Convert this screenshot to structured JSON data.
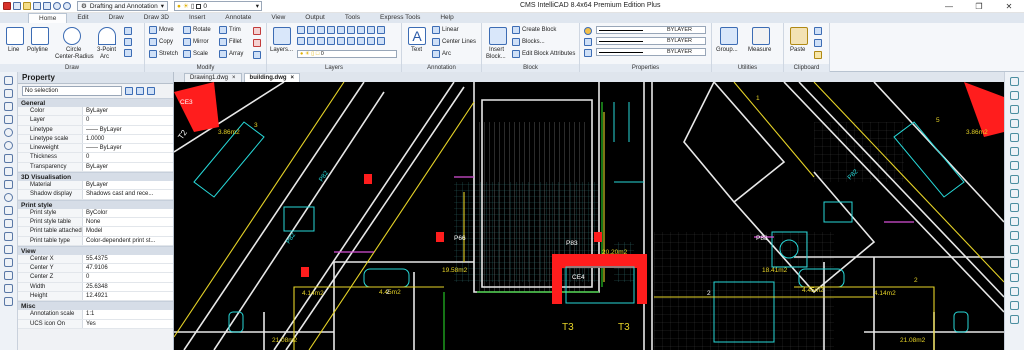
{
  "titlebar": {
    "workspace": "Drafting and Annotation",
    "layer_value": "0",
    "app_title": "CMS IntelliCAD 8.4x64 Premium Edition Plus"
  },
  "menu": [
    "Home",
    "Edit",
    "Draw",
    "Draw 3D",
    "Insert",
    "Annotate",
    "View",
    "Output",
    "Tools",
    "Express Tools",
    "Help"
  ],
  "ribbon": {
    "draw": {
      "label": "Draw",
      "line": "Line",
      "polyline": "Polyline",
      "circle": "Circle",
      "circle2": "Center-Radius",
      "arc": "3-Point",
      "arc2": "Arc"
    },
    "modify": {
      "label": "Modify",
      "items": [
        "Move",
        "Rotate",
        "Trim",
        "Copy",
        "Mirror",
        "Fillet",
        "Stretch",
        "Scale",
        "Array"
      ]
    },
    "layers": {
      "label": "Layers",
      "layers_btn": "Layers...",
      "layer_value": "0"
    },
    "annotation": {
      "label": "Annotation",
      "text": "Text",
      "linear": "Linear",
      "center_lines": "Center Lines",
      "arc": "Arc"
    },
    "block": {
      "label": "Block",
      "insert": "Insert",
      "insert2": "Block...",
      "create": "Create Block",
      "blocks": "Blocks...",
      "edit_attr": "Edit Block Attributes"
    },
    "properties": {
      "label": "Properties",
      "v1": "BYLAYER",
      "v2": "BYLAYER",
      "v3": "BYLAYER"
    },
    "utilities": {
      "label": "Utilities",
      "group": "Group...",
      "measure": "Measure"
    },
    "clipboard": {
      "label": "Clipboard",
      "paste": "Paste"
    }
  },
  "property_panel": {
    "title": "Property",
    "selection": "No selection",
    "sections": [
      {
        "name": "General",
        "rows": [
          [
            "Color",
            "ByLayer"
          ],
          [
            "Layer",
            "0"
          ],
          [
            "Linetype",
            "—— ByLayer"
          ],
          [
            "Linetype scale",
            "1.0000"
          ],
          [
            "Lineweight",
            "—— ByLayer"
          ],
          [
            "Thickness",
            "0"
          ],
          [
            "Transparency",
            "ByLayer"
          ]
        ]
      },
      {
        "name": "3D Visualisation",
        "rows": [
          [
            "Material",
            "ByLayer"
          ],
          [
            "Shadow display",
            "Shadows cast and rece..."
          ]
        ]
      },
      {
        "name": "Print style",
        "rows": [
          [
            "Print style",
            "ByColor"
          ],
          [
            "Print style table",
            "None"
          ],
          [
            "Print table attached to",
            "Model"
          ],
          [
            "Print table type",
            "Color-dependent print st..."
          ]
        ]
      },
      {
        "name": "View",
        "rows": [
          [
            "Center X",
            "55.4375"
          ],
          [
            "Center Y",
            "47.9106"
          ],
          [
            "Center Z",
            "0"
          ],
          [
            "Width",
            "25.6348"
          ],
          [
            "Height",
            "12.4921"
          ]
        ]
      },
      {
        "name": "Misc",
        "rows": [
          [
            "Annotation scale",
            "1:1"
          ],
          [
            "UCS icon On",
            "Yes"
          ]
        ]
      }
    ]
  },
  "doc_tabs": [
    "Drawing1.dwg",
    "building.dwg"
  ],
  "drawing": {
    "labels": [
      "CE3",
      "T2",
      "3.86m2",
      "P82",
      "3",
      "P82",
      "P66",
      "P83",
      "20.20m2",
      "19.58m2",
      "18.41m2",
      "CE4",
      "P88",
      "2",
      "4.14m2",
      "4.45m2",
      "4.45m2",
      "4.14m2",
      "T3",
      "T3",
      "21.08m2",
      "21.08m2",
      "P82",
      "3.86m2",
      "2",
      "5",
      "1",
      "2"
    ]
  },
  "colors": {
    "canvas": "#000000",
    "wall": "#e8e8e8",
    "cyan": "#27d9d9",
    "yellow": "#e6d327",
    "red": "#ff1d1d",
    "magenta": "#d64fd6",
    "green": "#25c025",
    "hatch": "#2e6a6a"
  }
}
